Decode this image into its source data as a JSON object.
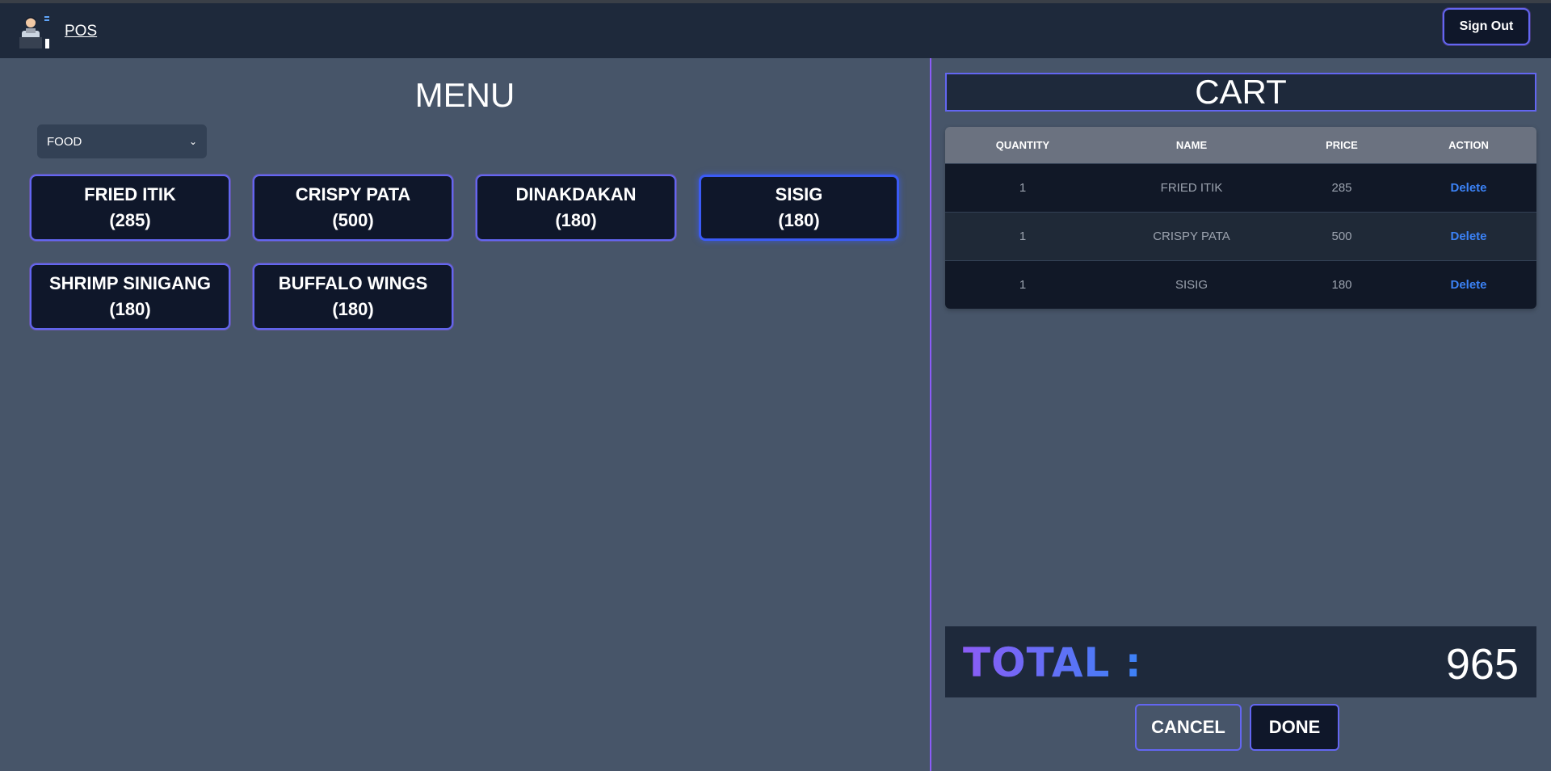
{
  "navbar": {
    "brand": "POS",
    "signout_label": "Sign Out"
  },
  "menu": {
    "title": "MENU",
    "category": {
      "selected": "FOOD"
    },
    "items": [
      {
        "name": "FRIED ITIK",
        "price": "(285)"
      },
      {
        "name": "CRISPY PATA",
        "price": "(500)"
      },
      {
        "name": "DINAKDAKAN",
        "price": "(180)"
      },
      {
        "name": "SISIG",
        "price": "(180)"
      },
      {
        "name": "SHRIMP SINIGANG",
        "price": "(180)"
      },
      {
        "name": "BUFFALO WINGS",
        "price": "(180)"
      }
    ]
  },
  "cart": {
    "title": "CART",
    "headers": [
      "QUANTITY",
      "NAME",
      "PRICE",
      "ACTION"
    ],
    "rows": [
      {
        "quantity": "1",
        "name": "FRIED ITIK",
        "price": "285",
        "action": "Delete"
      },
      {
        "quantity": "1",
        "name": "CRISPY PATA",
        "price": "500",
        "action": "Delete"
      },
      {
        "quantity": "1",
        "name": "SISIG",
        "price": "180",
        "action": "Delete"
      }
    ],
    "total_label": "TOTAL :",
    "total_value": "965",
    "cancel_label": "CANCEL",
    "done_label": "DONE"
  },
  "colors": {
    "background": "#475569",
    "navbar": "#1e293b",
    "accent": "#6366f1",
    "accent_purple": "#8b5cf6",
    "link": "#3b82f6"
  }
}
